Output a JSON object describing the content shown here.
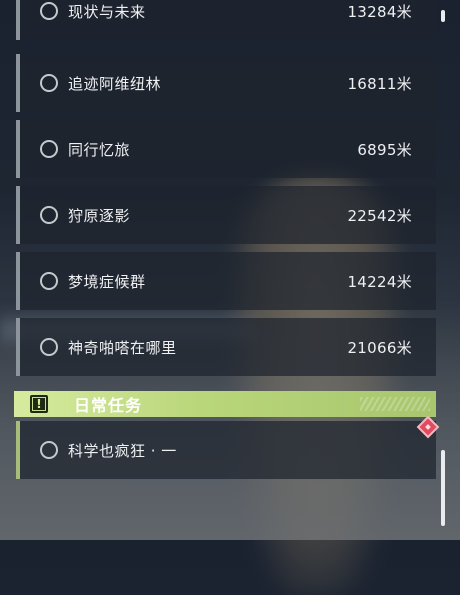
{
  "missions": [
    {
      "name": "现状与未来",
      "distance": "13284米"
    },
    {
      "name": "追迹阿维纽林",
      "distance": "16811米"
    },
    {
      "name": "同行忆旅",
      "distance": "6895米"
    },
    {
      "name": "狩原逐影",
      "distance": "22542米"
    },
    {
      "name": "梦境症候群",
      "distance": "14224米"
    },
    {
      "name": "神奇啪嗒在哪里",
      "distance": "21066米"
    }
  ],
  "daily_section": {
    "title": "日常任务",
    "icon": "exclamation-box-icon",
    "accent_color": "#b9d67a"
  },
  "daily_missions": [
    {
      "name": "科学也疯狂 · 一"
    }
  ],
  "badge_color": "#e34a5e"
}
